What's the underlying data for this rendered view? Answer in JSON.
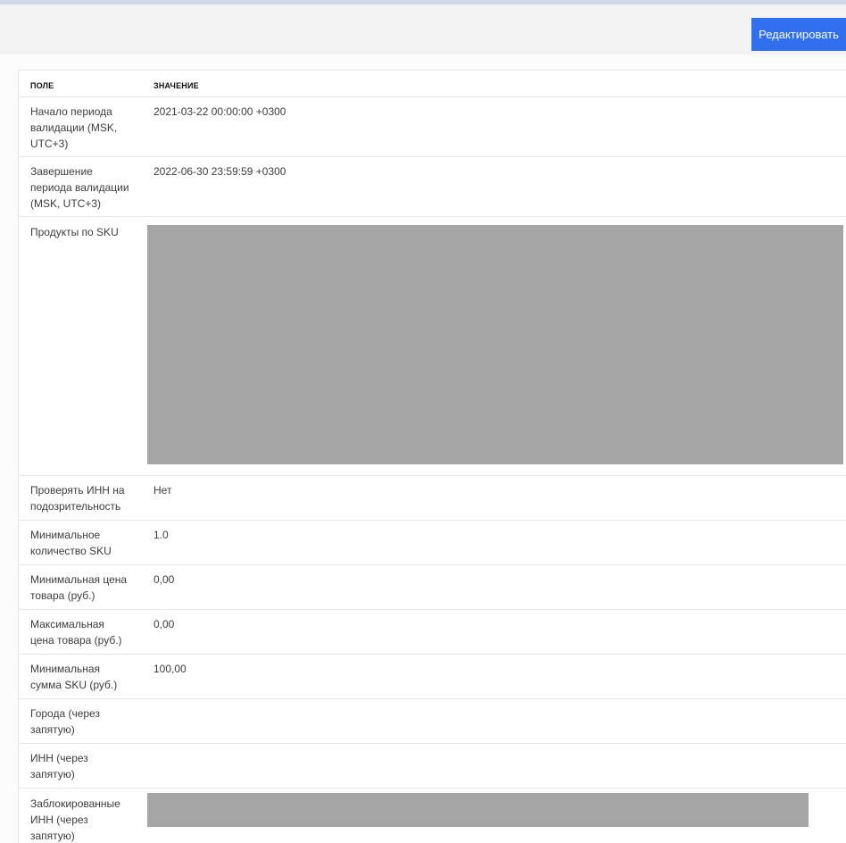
{
  "toolbar": {
    "edit_label": "Редактировать",
    "accent_color": "#2f6ff0"
  },
  "table": {
    "headers": {
      "field": "ПОЛЕ",
      "value": "ЗНАЧЕНИЕ"
    },
    "rows": [
      {
        "field": "Начало периода валидации (MSK, UTC+3)",
        "value": "2021-03-22 00:00:00 +0300"
      },
      {
        "field": "Завершение периода валидации (MSK, UTC+3)",
        "value": "2022-06-30 23:59:59 +0300"
      },
      {
        "field": "Продукты по SKU",
        "value": "",
        "redacted": true
      },
      {
        "field": "Проверять ИНН на подозрительность",
        "value": "Нет"
      },
      {
        "field": "Минимальное количество SKU",
        "value": "1.0"
      },
      {
        "field": "Минимальная цена товара (руб.)",
        "value": "0,00"
      },
      {
        "field": "Максимальная цена товара (руб.)",
        "value": "0,00"
      },
      {
        "field": "Минимальная сумма SKU (руб.)",
        "value": "100,00"
      },
      {
        "field": "Города (через запятую)",
        "value": ""
      },
      {
        "field": "ИНН (через запятую)",
        "value": ""
      },
      {
        "field": "Заблокированные ИНН (через запятую)",
        "value": "",
        "redacted": true
      }
    ]
  }
}
